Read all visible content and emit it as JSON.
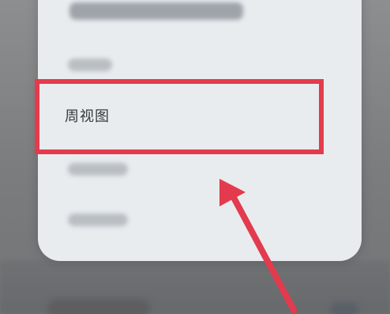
{
  "menu": {
    "selected_item_label": "周视图"
  },
  "colors": {
    "highlight": "#e33b4d",
    "menu_background": "#e8ecef",
    "overlay": "#7f8182"
  }
}
